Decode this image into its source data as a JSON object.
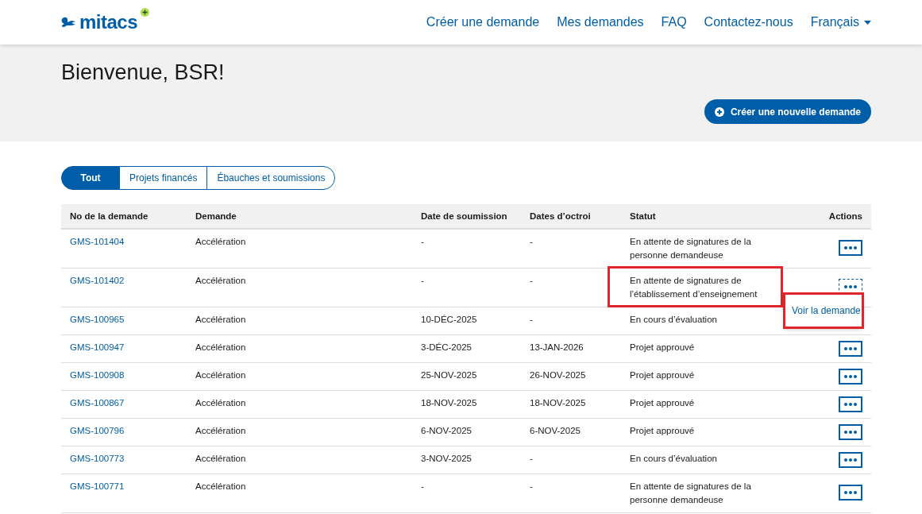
{
  "header": {
    "logo_text": "mitacs",
    "nav": [
      {
        "label": "Créer une demande",
        "dropdown": false
      },
      {
        "label": "Mes demandes",
        "dropdown": false
      },
      {
        "label": "FAQ",
        "dropdown": false
      },
      {
        "label": "Contactez-nous",
        "dropdown": false
      },
      {
        "label": "Français",
        "dropdown": true
      }
    ]
  },
  "hero": {
    "title": "Bienvenue, BSR!",
    "button": "Créer une nouvelle demande"
  },
  "tabs": [
    {
      "label": "Tout",
      "selected": true
    },
    {
      "label": "Projets financés",
      "selected": false
    },
    {
      "label": "Ébauches et soumissions",
      "selected": false
    }
  ],
  "table": {
    "columns": [
      "No de la demande",
      "Demande",
      "Date de soumission",
      "Dates d’octroi",
      "Statut",
      "Actions"
    ],
    "rows": [
      {
        "number": "GMS-101404",
        "type": "Accélération",
        "submitted": "-",
        "granted": "-",
        "status": "En attente de signatures de la personne demandeuse",
        "status_highlighted": false,
        "menu_open": false
      },
      {
        "number": "GMS-101402",
        "type": "Accélération",
        "submitted": "-",
        "granted": "-",
        "status": "En attente de signatures de l’établissement d’enseignement",
        "status_highlighted": true,
        "menu_open": true,
        "menu_items": [
          {
            "label": "Voir la demande",
            "highlighted": true
          }
        ]
      },
      {
        "number": "GMS-100965",
        "type": "Accélération",
        "submitted": "10-DÉC-2025",
        "granted": "-",
        "status": "En cours d’évaluation",
        "status_highlighted": false
      },
      {
        "number": "GMS-100947",
        "type": "Accélération",
        "submitted": "3-DÉC-2025",
        "granted": "13-JAN-2026",
        "status": "Projet approuvé",
        "status_highlighted": false,
        "menu_open": false
      },
      {
        "number": "GMS-100908",
        "type": "Accélération",
        "submitted": "25-NOV-2025",
        "granted": "26-NOV-2025",
        "status": "Projet approuvé",
        "status_highlighted": false,
        "menu_open": false
      },
      {
        "number": "GMS-100867",
        "type": "Accélération",
        "submitted": "18-NOV-2025",
        "granted": "18-NOV-2025",
        "status": "Projet approuvé",
        "status_highlighted": false,
        "menu_open": false
      },
      {
        "number": "GMS-100796",
        "type": "Accélération",
        "submitted": "6-NOV-2025",
        "granted": "6-NOV-2025",
        "status": "Projet approuvé",
        "status_highlighted": false,
        "menu_open": false
      },
      {
        "number": "GMS-100773",
        "type": "Accélération",
        "submitted": "3-NOV-2025",
        "granted": "-",
        "status": "En cours d’évaluation",
        "status_highlighted": false,
        "menu_open": false
      },
      {
        "number": "GMS-100771",
        "type": "Accélération",
        "submitted": "-",
        "granted": "-",
        "status": "En attente de signatures de la personne demandeuse",
        "status_highlighted": false,
        "menu_open": false
      }
    ]
  }
}
